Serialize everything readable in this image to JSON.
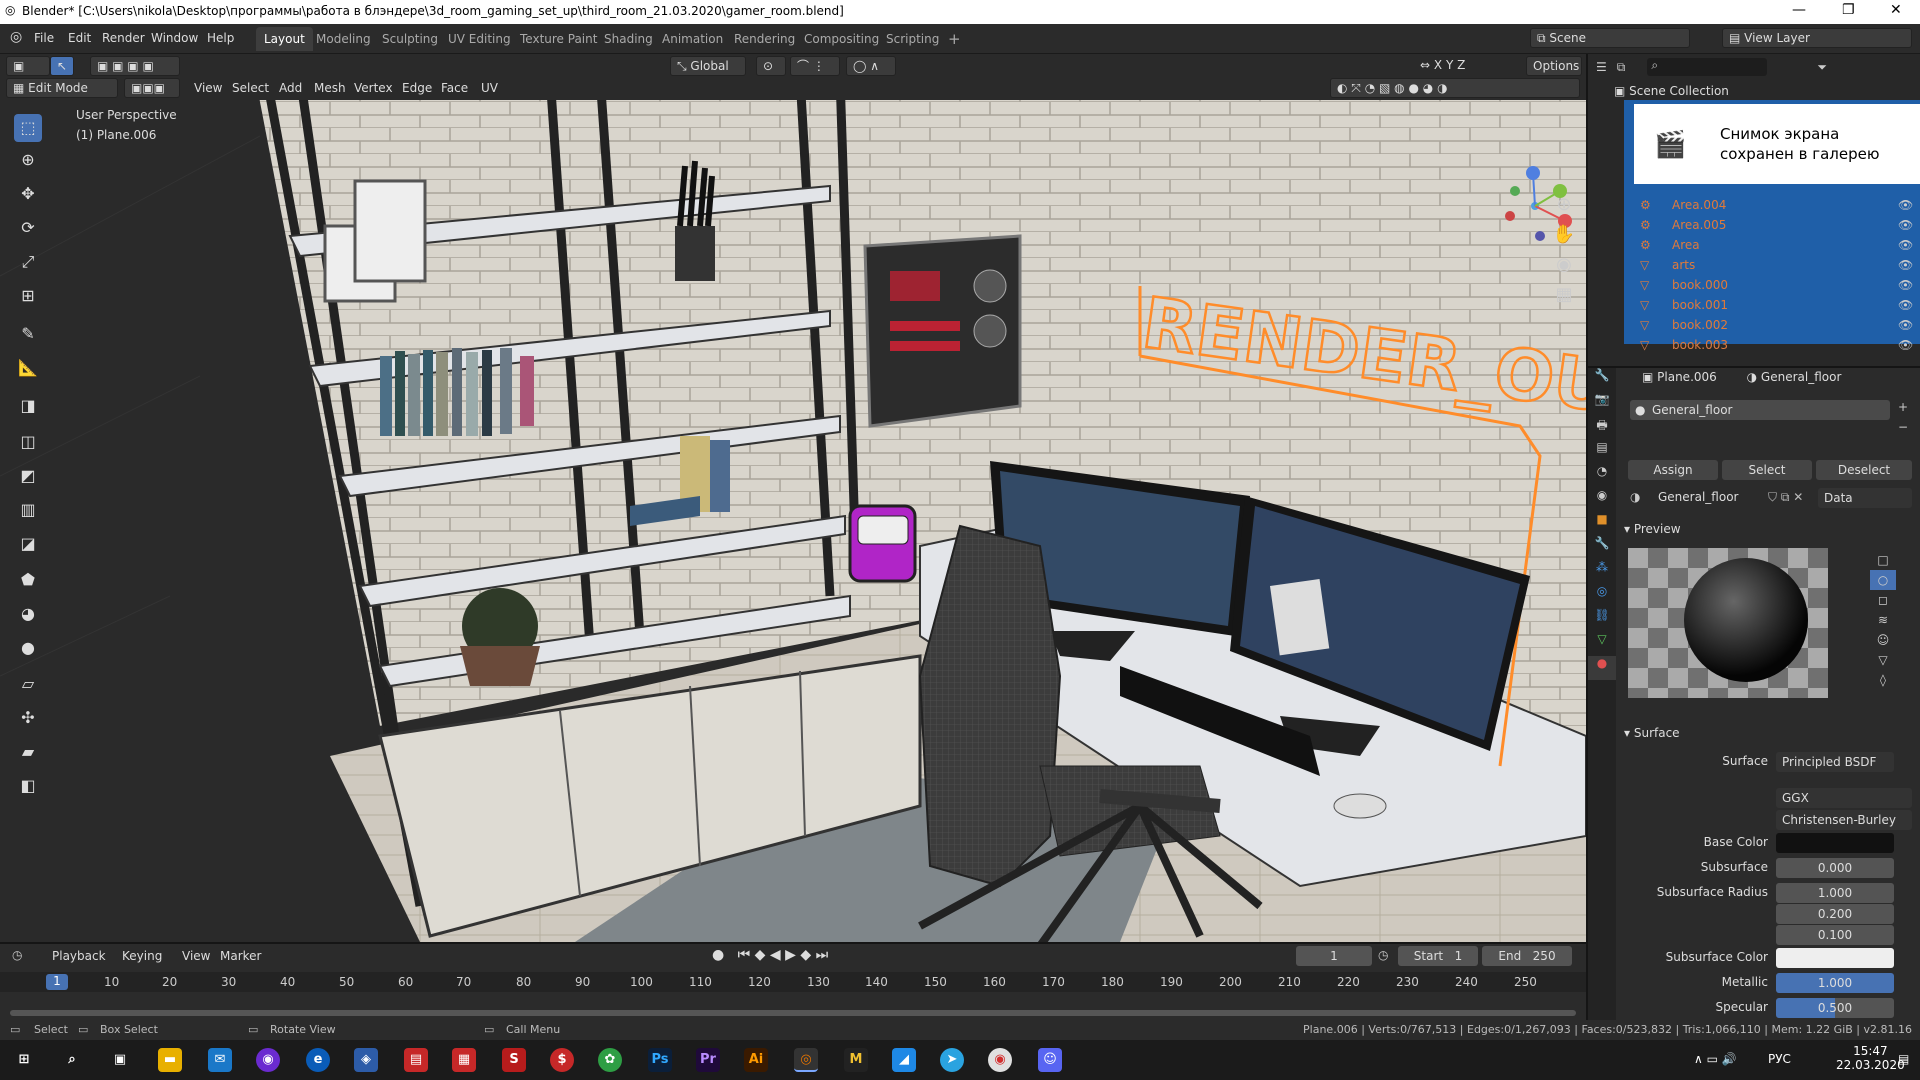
{
  "window": {
    "title": "Blender* [C:\\Users\\nikola\\Desktop\\программы\\работа в блэндере\\3d_room_gaming_set_up\\third_room_21.03.2020\\gamer_room.blend]",
    "min": "—",
    "max": "❐",
    "close": "✕"
  },
  "menu": [
    "File",
    "Edit",
    "Render",
    "Window",
    "Help"
  ],
  "workspaces": [
    "Layout",
    "Modeling",
    "Sculpting",
    "UV Editing",
    "Texture Paint",
    "Shading",
    "Animation",
    "Rendering",
    "Compositing",
    "Scripting"
  ],
  "add_workspace": "+",
  "scene": {
    "label": "Scene",
    "view_layer": "View Layer"
  },
  "viewport_header": {
    "mode": "Edit Mode",
    "menus": [
      "View",
      "Select",
      "Add",
      "Mesh",
      "Vertex",
      "Edge",
      "Face",
      "UV"
    ],
    "orientation": "Global",
    "options": "Options",
    "axes": [
      "X",
      "Y",
      "Z"
    ]
  },
  "viewport": {
    "perspective": "User Perspective",
    "object": "(1) Plane.006",
    "neon_text": "RENDER_OUT"
  },
  "toast": {
    "text": "Снимок экрана сохранен в галерею"
  },
  "outliner": {
    "title": "Scene Collection",
    "items": [
      "Area.004",
      "Area.005",
      "Area",
      "arts",
      "book.000",
      "book.001",
      "book.002",
      "book.003"
    ]
  },
  "properties": {
    "object": "Plane.006",
    "material": "General_floor",
    "slot": "General_floor",
    "buttons": [
      "Assign",
      "Select",
      "Deselect"
    ],
    "mat_field": "General_floor",
    "link": "Data",
    "preview_label": "Preview",
    "surface_label": "Surface",
    "surface_shader": "Principled BSDF",
    "distribution": "GGX",
    "subsurface_method": "Christensen-Burley",
    "fields": [
      {
        "label": "Surface",
        "value": "Principled BSDF"
      },
      {
        "label": "Base Color",
        "value": ""
      },
      {
        "label": "Subsurface",
        "value": "0.000"
      },
      {
        "label": "Subsurface Radius",
        "value": "1.000"
      },
      {
        "label": "",
        "value": "0.200"
      },
      {
        "label": "",
        "value": "0.100"
      },
      {
        "label": "Subsurface Color",
        "value": ""
      },
      {
        "label": "Metallic",
        "value": "1.000"
      },
      {
        "label": "Specular",
        "value": "0.500"
      }
    ]
  },
  "timeline": {
    "menus": [
      "Playback",
      "Keying",
      "View",
      "Marker"
    ],
    "current_frame": "1",
    "start_label": "Start",
    "start": "1",
    "end_label": "End",
    "end": "250",
    "ticks": [
      "1",
      "10",
      "20",
      "30",
      "40",
      "50",
      "60",
      "70",
      "80",
      "90",
      "100",
      "110",
      "120",
      "130",
      "140",
      "150",
      "160",
      "170",
      "180",
      "190",
      "200",
      "210",
      "220",
      "230",
      "240",
      "250"
    ]
  },
  "status": {
    "select": "Select",
    "box_select": "Box Select",
    "rotate": "Rotate View",
    "call_menu": "Call Menu",
    "stats": "Plane.006 | Verts:0/767,513 | Edges:0/1,267,093 | Faces:0/523,832 | Tris:1,066,110 | Mem: 1.22 GiB | v2.81.16"
  },
  "taskbar": {
    "lang": "РУС",
    "time": "15:47",
    "date": "22.03.2020",
    "icons": [
      "Ps",
      "Pr",
      "Ai",
      "M"
    ]
  },
  "colors": {
    "accent": "#4772b3",
    "neon": "#ff8c2a",
    "outliner_sel": "#1f5fa8",
    "toast_bg": "#ffffff"
  }
}
